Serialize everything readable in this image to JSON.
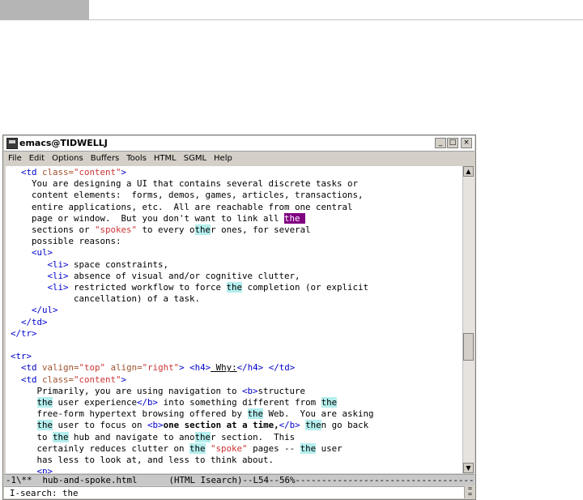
{
  "window": {
    "title": "emacs@TIDWELLJ",
    "minimize_glyph": "_",
    "maximize_glyph": "□",
    "close_glyph": "×"
  },
  "menu": [
    "File",
    "Edit",
    "Options",
    "Buffers",
    "Tools",
    "HTML",
    "SGML",
    "Help"
  ],
  "scrollbar": {
    "up_glyph": "▲",
    "down_glyph": "▼",
    "position_percent": 56
  },
  "modeline": "-1\\**  hub-and-spoke.html      (HTML Isearch)--L54--56%--------------------------------------",
  "minibuffer": "I-search: the",
  "minibuffer_tools": "⁼\n⁼",
  "search_term": "the",
  "code_lines": [
    [
      {
        "c": "tg",
        "t": "  <td "
      },
      {
        "c": "at",
        "t": "class="
      },
      {
        "c": "st",
        "t": "\"content\""
      },
      {
        "c": "tg",
        "t": ">"
      }
    ],
    [
      {
        "t": "    You are designing a UI that contains several discrete tasks or"
      }
    ],
    [
      {
        "t": "    content elements:  forms, demos, games, articles, transactions,"
      }
    ],
    [
      {
        "t": "    entire applications, etc.  All are reachable from one central"
      }
    ],
    [
      {
        "t": "    page or window.  But you don't want to link all "
      },
      {
        "c": "cur",
        "t": "the "
      }
    ],
    [
      {
        "t": "    sections or "
      },
      {
        "c": "st",
        "t": "\"spokes\""
      },
      {
        "t": " to every o"
      },
      {
        "c": "hl",
        "t": "the"
      },
      {
        "t": "r ones, for several"
      }
    ],
    [
      {
        "t": "    possible reasons:"
      }
    ],
    [
      {
        "c": "tg",
        "t": "    <ul>"
      }
    ],
    [
      {
        "c": "tg",
        "t": "       <li>"
      },
      {
        "t": " space constraints,"
      }
    ],
    [
      {
        "c": "tg",
        "t": "       <li>"
      },
      {
        "t": " absence of visual and/or cognitive clutter,"
      }
    ],
    [
      {
        "c": "tg",
        "t": "       <li>"
      },
      {
        "t": " restricted workflow to force "
      },
      {
        "c": "hl",
        "t": "the"
      },
      {
        "t": " completion (or explicit"
      }
    ],
    [
      {
        "t": "            cancellation) of a task."
      }
    ],
    [
      {
        "c": "tg",
        "t": "    </ul>"
      }
    ],
    [
      {
        "c": "tg",
        "t": "  </td>"
      }
    ],
    [
      {
        "c": "tg",
        "t": "</tr>"
      }
    ],
    [
      {
        "t": ""
      }
    ],
    [
      {
        "c": "tg",
        "t": "<tr>"
      }
    ],
    [
      {
        "c": "tg",
        "t": "  <td "
      },
      {
        "c": "at",
        "t": "valign="
      },
      {
        "c": "st",
        "t": "\"top\""
      },
      {
        "t": " "
      },
      {
        "c": "at",
        "t": "align="
      },
      {
        "c": "st",
        "t": "\"right\""
      },
      {
        "c": "tg",
        "t": ">"
      },
      {
        "t": " "
      },
      {
        "c": "tg",
        "t": "<h4>"
      },
      {
        "c": "ul",
        "t": " Why:"
      },
      {
        "c": "tg",
        "t": "</h4>"
      },
      {
        "t": " "
      },
      {
        "c": "tg",
        "t": "</td>"
      }
    ],
    [
      {
        "c": "tg",
        "t": "  <td "
      },
      {
        "c": "at",
        "t": "class="
      },
      {
        "c": "st",
        "t": "\"content\""
      },
      {
        "c": "tg",
        "t": ">"
      }
    ],
    [
      {
        "t": "     Primarily, you are using navigation to "
      },
      {
        "c": "tg",
        "t": "<b>"
      },
      {
        "t": "structure"
      }
    ],
    [
      {
        "t": "     "
      },
      {
        "c": "hl",
        "t": "the"
      },
      {
        "t": " user experience"
      },
      {
        "c": "tg",
        "t": "</b>"
      },
      {
        "t": " into something different from "
      },
      {
        "c": "hl",
        "t": "the"
      }
    ],
    [
      {
        "t": "     free-form hypertext browsing offered by "
      },
      {
        "c": "hl",
        "t": "the"
      },
      {
        "t": " Web.  You are asking"
      }
    ],
    [
      {
        "t": "     "
      },
      {
        "c": "hl",
        "t": "the"
      },
      {
        "t": " user to focus on "
      },
      {
        "c": "tg",
        "t": "<b>"
      },
      {
        "c": "b",
        "t": "one section at a time,"
      },
      {
        "c": "tg",
        "t": "</b>"
      },
      {
        "t": " "
      },
      {
        "c": "hl",
        "t": "the"
      },
      {
        "t": "n go back"
      }
    ],
    [
      {
        "t": "     to "
      },
      {
        "c": "hl",
        "t": "the"
      },
      {
        "t": " hub and navigate to ano"
      },
      {
        "c": "hl",
        "t": "the"
      },
      {
        "t": "r section.  This"
      }
    ],
    [
      {
        "t": "     certainly reduces clutter on "
      },
      {
        "c": "hl",
        "t": "the"
      },
      {
        "t": " "
      },
      {
        "c": "st",
        "t": "\"spoke\""
      },
      {
        "t": " pages -- "
      },
      {
        "c": "hl",
        "t": "the"
      },
      {
        "t": " user"
      }
    ],
    [
      {
        "t": "     has less to look at, and less to think about."
      }
    ],
    [
      {
        "c": "tg",
        "t": "     <p>"
      }
    ]
  ]
}
